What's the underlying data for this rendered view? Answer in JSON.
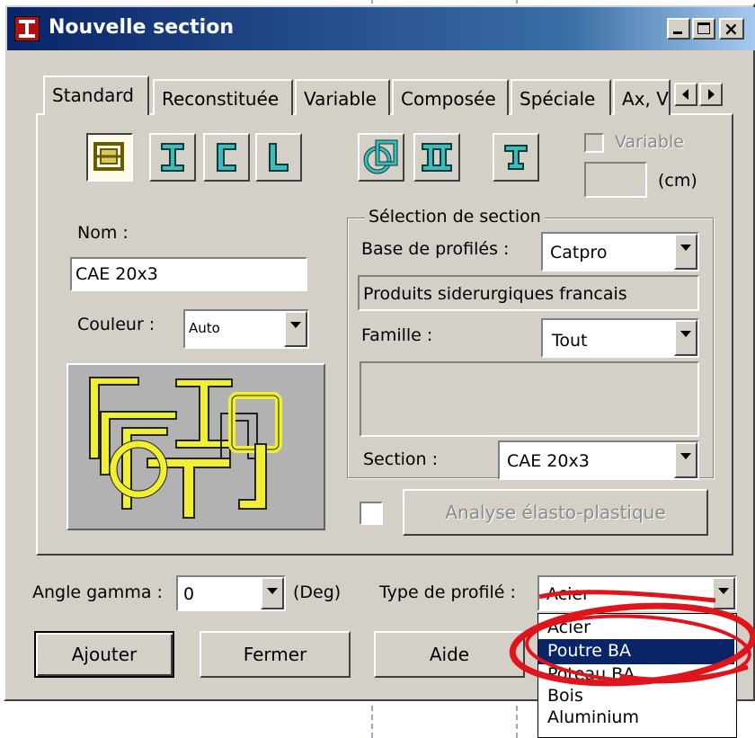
{
  "window": {
    "title": "Nouvelle section"
  },
  "tabs": [
    "Standard",
    "Reconstituée",
    "Variable",
    "Composée",
    "Spéciale",
    "Ax, V"
  ],
  "toolbar": {
    "variable_label": "Variable",
    "unit_label": "(cm)",
    "icons": [
      "composite-section-icon",
      "i-beam-icon",
      "channel-section-icon",
      "angle-section-icon",
      "tube-section-icon",
      "double-i-icon",
      "tee-section-icon"
    ]
  },
  "name": {
    "label": "Nom :",
    "value": "CAE 20x3"
  },
  "color": {
    "label": "Couleur :",
    "value": "Auto"
  },
  "selection": {
    "group_title": "Sélection de section",
    "base_label": "Base de profilés :",
    "base_value": "Catpro",
    "base_description": "Produits siderurgiques francais",
    "family_label": "Famille :",
    "family_value": "Tout",
    "section_label": "Section :",
    "section_value": "CAE 20x3"
  },
  "analysis_button": "Analyse élasto-plastique",
  "angle": {
    "label": "Angle gamma :",
    "value": "0",
    "unit": "(Deg)"
  },
  "profile_type": {
    "label": "Type de profilé :",
    "value": "Acier",
    "options": [
      "Acier",
      "Poutre BA",
      "Poteau BA",
      "Bois",
      "Aluminium"
    ],
    "highlighted": "Poutre BA"
  },
  "buttons": {
    "add": "Ajouter",
    "close": "Fermer",
    "help": "Aide"
  },
  "colors": {
    "titlebar": "#0a246a",
    "face": "#d4d0c8",
    "teal": "#3cbdb9",
    "highlight": "#0a246a",
    "annotation": "#e0141c"
  }
}
